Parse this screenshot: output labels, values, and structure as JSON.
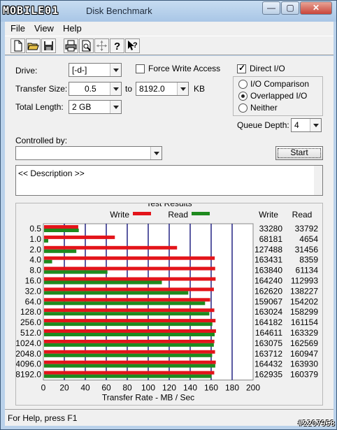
{
  "window": {
    "logo_text": "MOBILE01",
    "title": "Disk Benchmark",
    "min_glyph": "—",
    "max_glyph": "▢",
    "close_glyph": "✕"
  },
  "menu": {
    "file": "File",
    "view": "View",
    "help": "Help"
  },
  "toolbar": {
    "icons": [
      "new-icon",
      "open-icon",
      "save-icon",
      "print-icon",
      "print-preview-icon",
      "move-icon",
      "help-icon",
      "context-help-icon"
    ]
  },
  "settings": {
    "drive_label": "Drive:",
    "drive_value": "[-d-]",
    "force_write_label": "Force Write Access",
    "force_write_checked": false,
    "direct_io_label": "Direct I/O",
    "direct_io_checked": true,
    "transfer_size_label": "Transfer Size:",
    "transfer_from": "0.5",
    "to_label": "to",
    "transfer_to": "8192.0",
    "kb_label": "KB",
    "total_length_label": "Total Length:",
    "total_length_value": "2 GB",
    "io_options": [
      {
        "label": "I/O Comparison",
        "selected": false
      },
      {
        "label": "Overlapped I/O",
        "selected": true
      },
      {
        "label": "Neither",
        "selected": false
      }
    ],
    "queue_depth_label": "Queue Depth:",
    "queue_depth_value": "4",
    "controlled_by_label": "Controlled by:",
    "controlled_by_value": "",
    "start_label": "Start",
    "description": "<< Description >>"
  },
  "results": {
    "title": "Test Results",
    "write_legend": "Write",
    "read_legend": "Read",
    "write_col": "Write",
    "read_col": "Read",
    "write_color": "#e3141a",
    "read_color": "#1e8a1e",
    "grid_color": "#14147a"
  },
  "chart_data": {
    "type": "bar",
    "orientation": "horizontal",
    "xlabel": "Transfer Rate - MB / Sec",
    "xlim": [
      0,
      200
    ],
    "xticks": [
      0,
      20,
      40,
      60,
      80,
      100,
      120,
      140,
      160,
      180,
      200
    ],
    "categories": [
      "0.5",
      "1.0",
      "2.0",
      "4.0",
      "8.0",
      "16.0",
      "32.0",
      "64.0",
      "128.0",
      "256.0",
      "512.0",
      "1024.0",
      "2048.0",
      "4096.0",
      "8192.0"
    ],
    "series": [
      {
        "name": "Write",
        "values": [
          33280,
          68181,
          127488,
          163431,
          163840,
          164240,
          162620,
          159067,
          163024,
          164182,
          164611,
          163075,
          163712,
          164432,
          162935
        ]
      },
      {
        "name": "Read",
        "values": [
          33792,
          4654,
          31456,
          8359,
          61134,
          112993,
          138227,
          154202,
          158299,
          161154,
          163329,
          162569,
          160947,
          163930,
          160379
        ]
      }
    ],
    "value_unit_divisor": 1000
  },
  "status": {
    "text": "For Help, press F1",
    "watermark": "#2207958"
  }
}
